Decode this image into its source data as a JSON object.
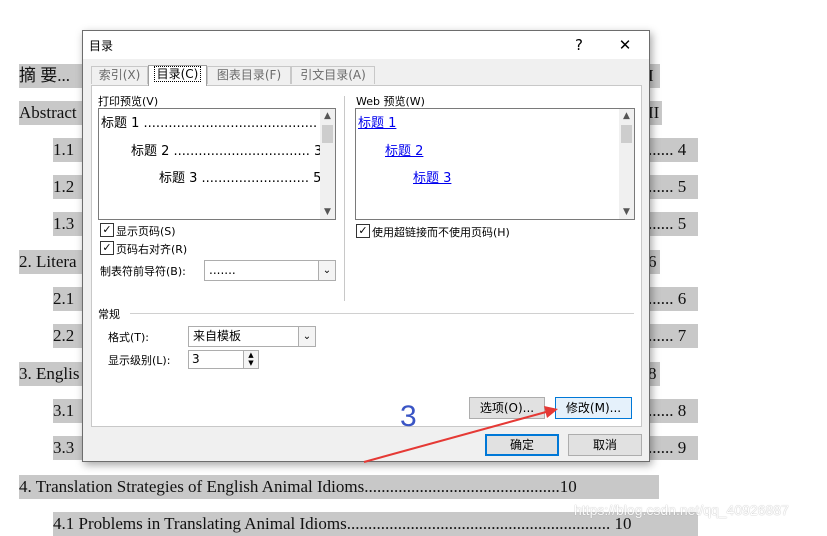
{
  "document": {
    "lines": [
      {
        "text": "摘 要...",
        "right": "I"
      },
      {
        "text": "Abstract",
        "right": "II"
      },
      {
        "text": "1.1",
        "right": "...... 4"
      },
      {
        "text": "1.2",
        "right": "...... 5"
      },
      {
        "text": "1.3",
        "right": "...... 5"
      },
      {
        "text": "2. Litera",
        "right": "6"
      },
      {
        "text": "2.1",
        "right": "...... 6"
      },
      {
        "text": "2.2",
        "right": "...... 7"
      },
      {
        "text": "3. Englis",
        "right": "8"
      },
      {
        "text": "3.1",
        "right": "...... 8"
      },
      {
        "text": "3.3",
        "right": "...... 9"
      },
      {
        "text": "4. Translation Strategies of English Animal Idioms..............................................10",
        "right": ""
      },
      {
        "text": "4.1 Problems in Translating Animal Idioms.............................................................. 10",
        "right": ""
      }
    ],
    "annotation": "3",
    "watermark": "https://blog.csdn.net/qq_40926887"
  },
  "dialog": {
    "title": "目录",
    "help": "?",
    "close": "✕",
    "tabs": [
      {
        "label": "索引(X)",
        "active": false
      },
      {
        "label": "目录(C)",
        "active": true
      },
      {
        "label": "图表目录(F)",
        "active": false
      },
      {
        "label": "引文目录(A)",
        "active": false
      }
    ],
    "print_preview": {
      "label": "打印预览(V)",
      "lines": [
        {
          "text": "标题 1 .......................................... 1"
        },
        {
          "text": "标题 2 ................................. 3"
        },
        {
          "text": "标题 3 .......................... 5"
        }
      ]
    },
    "web_preview": {
      "label": "Web 预览(W)",
      "lines": [
        "标题 1",
        "标题 2",
        "标题 3"
      ]
    },
    "options": {
      "show_page_numbers": {
        "label": "显示页码(S)",
        "checked": true
      },
      "right_align": {
        "label": "页码右对齐(R)",
        "checked": true
      },
      "tab_leader_label": "制表符前导符(B):",
      "tab_leader_value": ".......",
      "use_hyperlinks": {
        "label": "使用超链接而不使用页码(H)",
        "checked": true
      }
    },
    "general": {
      "heading": "常规",
      "format_label": "格式(T):",
      "format_value": "来自模板",
      "levels_label": "显示级别(L):",
      "levels_value": "3"
    },
    "buttons": {
      "options": "选项(O)...",
      "modify": "修改(M)...",
      "ok": "确定",
      "cancel": "取消"
    }
  },
  "colors": {
    "accent": "#0078d7",
    "annotation": "#3a55c5",
    "arrow": "#e53935",
    "highlight": "#c8c8c8"
  }
}
